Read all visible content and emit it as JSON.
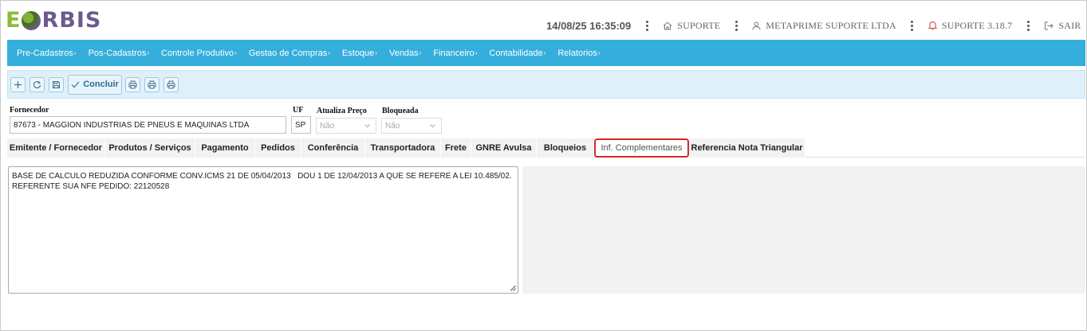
{
  "brand": {
    "letter_e": "E",
    "rest": "RBIS",
    "logo_colors": {
      "green": "#8dbb3a",
      "purple": "#6b5b8d"
    }
  },
  "header": {
    "datetime": "14/08/25 16:35:09",
    "support_link": "SUPORTE",
    "company": "METAPRIME SUPORTE LTDA",
    "version": "SUPORTE 3.18.7",
    "logout": "SAIR",
    "icons": [
      "home-icon",
      "user-icon",
      "bell-icon",
      "logout-icon"
    ]
  },
  "nav": {
    "color": "#35aedc",
    "items": [
      {
        "label": "Pre-Cadastros"
      },
      {
        "label": "Pos-Cadastros"
      },
      {
        "label": "Controle Produtivo"
      },
      {
        "label": "Gestao de Compras"
      },
      {
        "label": "Estoque"
      },
      {
        "label": "Vendas"
      },
      {
        "label": "Financeiro"
      },
      {
        "label": "Contabilidade"
      },
      {
        "label": "Relatorios"
      }
    ],
    "caret": "›"
  },
  "toolbar": {
    "concluir_label": "Concluir",
    "icons": [
      "plus-icon",
      "refresh-icon",
      "save-icon",
      "check-icon",
      "print-icon",
      "print-icon",
      "print-icon"
    ]
  },
  "form": {
    "fornecedor": {
      "label": "Fornecedor",
      "value": "87673 - MAGGION INDUSTRIAS DE PNEUS E MAQUINAS LTDA"
    },
    "uf": {
      "label": "UF",
      "value": "SP"
    },
    "atualiza_preco": {
      "label": "Atualiza Preço",
      "value": "Não"
    },
    "bloqueada": {
      "label": "Bloqueada",
      "value": "Não"
    }
  },
  "tabs": {
    "items": [
      {
        "label": "Emitente / Fornecedor"
      },
      {
        "label": "Produtos / Serviços"
      },
      {
        "label": "Pagamento"
      },
      {
        "label": "Pedidos"
      },
      {
        "label": "Conferência"
      },
      {
        "label": "Transportadora"
      },
      {
        "label": "Frete"
      },
      {
        "label": "GNRE Avulsa"
      },
      {
        "label": "Bloqueios"
      },
      {
        "label": "Inf. Complementares"
      },
      {
        "label": "Referencia Nota Triangular"
      }
    ],
    "active": "Inf. Complementares",
    "highlight_color": "#d22a2a"
  },
  "content": {
    "lines": [
      "BASE DE CALCULO REDUZIDA CONFORME CONV.ICMS 21 DE 05/04/2013   DOU 1 DE 12/04/2013 A QUE SE REFERE A LEI 10.485/02.",
      "REFERENTE SUA NFE PEDIDO: 22120528"
    ]
  }
}
